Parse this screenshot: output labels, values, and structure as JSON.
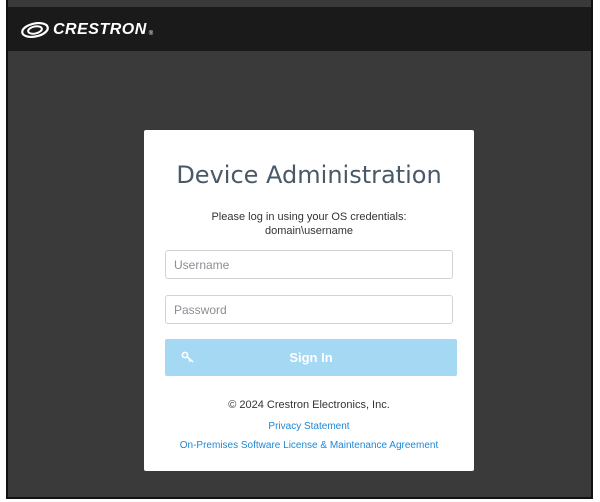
{
  "brand": {
    "name": "CRESTRON",
    "registered": "®"
  },
  "login": {
    "title": "Device Administration",
    "instruction_line1": "Please log in using your OS credentials:",
    "instruction_line2": "domain\\username",
    "username_placeholder": "Username",
    "username_value": "",
    "password_placeholder": "Password",
    "password_value": "",
    "sign_in_label": "Sign In",
    "sign_in_icon": "key-icon"
  },
  "footer": {
    "copyright": "© 2024 Crestron Electronics, Inc.",
    "privacy_link": "Privacy Statement",
    "license_link": "On-Premises Software License & Maintenance Agreement"
  },
  "colors": {
    "page_background": "#3a3a3a",
    "header_background": "#1a1a1a",
    "card_background": "#ffffff",
    "sign_in_button": "#a5d8f3",
    "link": "#1e88d8",
    "title": "#4a5968"
  }
}
